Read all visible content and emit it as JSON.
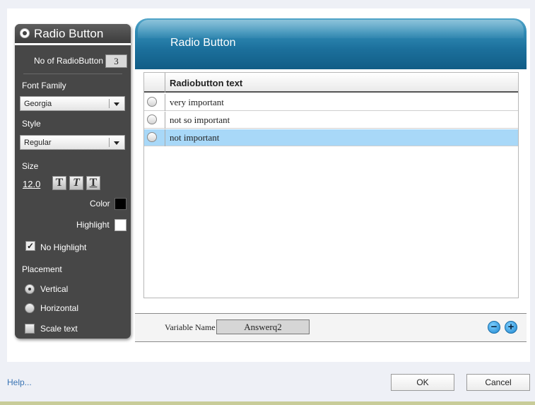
{
  "props": {
    "title": "Radio Button",
    "count_label": "No of RadioButton",
    "count_value": "3",
    "font_family_label": "Font Family",
    "font_family_value": "Georgia",
    "style_label": "Style",
    "style_value": "Regular",
    "size_label": "Size",
    "size_value": "12.0",
    "text_buttons": [
      "T",
      "T",
      "T"
    ],
    "color_label": "Color",
    "color_value": "#000000",
    "highlight_label": "Highlight",
    "highlight_value": "#ffffff",
    "no_highlight_label": "No Highlight",
    "no_highlight_checked": true,
    "placement_label": "Placement",
    "vertical_label": "Vertical",
    "horizontal_label": "Horizontal",
    "placement_selected": "Vertical",
    "scale_text_label": "Scale text",
    "scale_text_checked": false
  },
  "editor": {
    "title": "Radio Button",
    "header_color": "#1c709c",
    "column_header": "Radiobutton text",
    "rows": [
      {
        "text": "very important",
        "selected": false
      },
      {
        "text": "not so important",
        "selected": false
      },
      {
        "text": "not important",
        "selected": true
      }
    ],
    "selected_row_color": "#a8d8f8",
    "variable_label": "Variable Name",
    "variable_value": "Answerq2",
    "minus_label": "−",
    "plus_label": "+"
  },
  "footer": {
    "help_label": "Help...",
    "ok_label": "OK",
    "cancel_label": "Cancel"
  }
}
